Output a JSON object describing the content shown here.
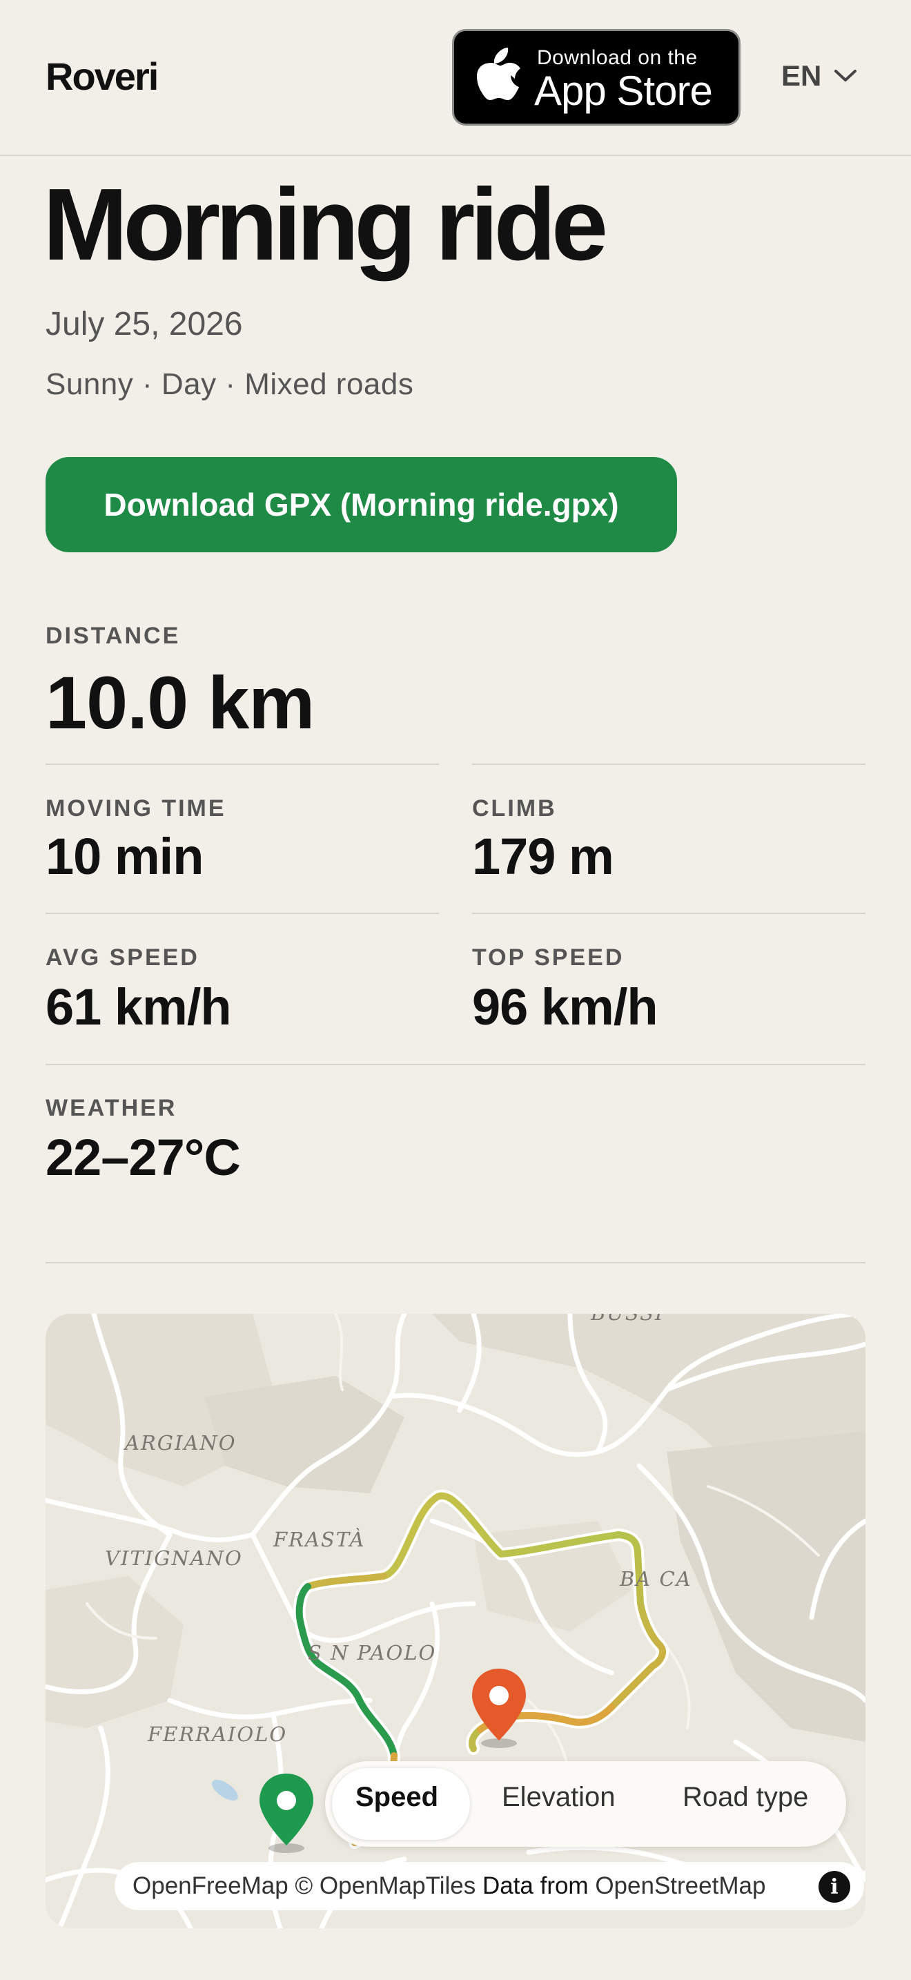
{
  "header": {
    "logo": "Roveri",
    "appstore_small": "Download on the",
    "appstore_big": "App Store",
    "language": "EN"
  },
  "ride": {
    "title": "Morning ride",
    "date": "July 25, 2026",
    "meta": "Sunny · Day · Mixed roads",
    "download_label": "Download GPX (Morning ride.gpx)"
  },
  "stats": {
    "distance": {
      "label": "DISTANCE",
      "value": "10.0 km"
    },
    "moving_time": {
      "label": "MOVING TIME",
      "value": "10 min"
    },
    "climb": {
      "label": "CLIMB",
      "value": "179 m"
    },
    "avg_speed": {
      "label": "AVG SPEED",
      "value": "61 km/h"
    },
    "top_speed": {
      "label": "TOP SPEED",
      "value": "96 km/h"
    },
    "weather": {
      "label": "WEATHER",
      "value": "22–27°C"
    }
  },
  "map": {
    "places": [
      "ARGIANO",
      "VITIGNANO",
      "FRASTÀ",
      "BA  CA",
      "S  N PAOLO",
      "FERRAIOLO",
      "BUSSI"
    ],
    "tabs": [
      "Speed",
      "Elevation",
      "Road type"
    ],
    "active_tab": "Speed",
    "attribution_prefix": "OpenFreeMap © OpenMapTiles ",
    "attribution_mid": "Data from ",
    "attribution_osm": "OpenStreetMap",
    "info": "i",
    "colors": {
      "start": "#1e9a4e",
      "end": "#e55a2b",
      "route_fast": "#b8c24a",
      "route_slow": "#2a9a4c"
    }
  }
}
